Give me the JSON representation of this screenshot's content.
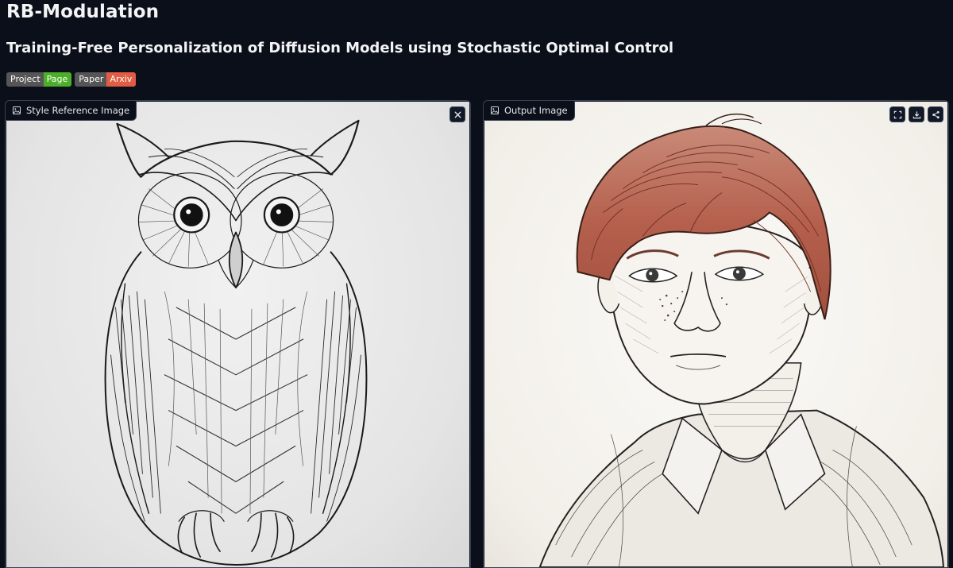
{
  "app": {
    "title": "RB-Modulation",
    "subtitle": "Training-Free Personalization of Diffusion Models using Stochastic Optimal Control"
  },
  "badges": [
    {
      "label": "Project",
      "value": "Page",
      "color": "#4caf2a"
    },
    {
      "label": "Paper",
      "value": "Arxiv",
      "color": "#e05d44"
    }
  ],
  "panels": {
    "style_reference": {
      "label": "Style Reference Image",
      "icon": "image-icon",
      "action": "close-icon"
    },
    "output": {
      "label": "Output Image",
      "icon": "image-icon",
      "actions": [
        "fullscreen-icon",
        "download-icon",
        "share-icon"
      ]
    }
  },
  "colors": {
    "background": "#0b0f19",
    "border": "#374151",
    "accent_hair": "#b5604d"
  }
}
